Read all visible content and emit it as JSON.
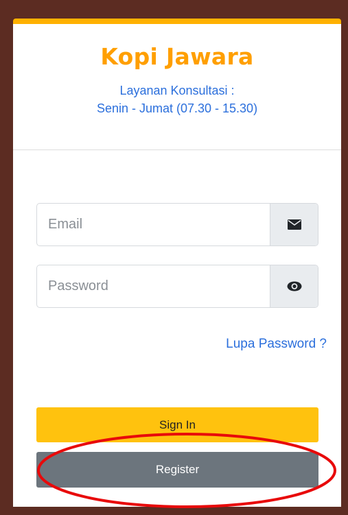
{
  "header": {
    "title": "Kopi Jawara",
    "consult_line1": "Layanan Konsultasi :",
    "consult_line2": "Senin - Jumat (07.30 - 15.30)"
  },
  "form": {
    "email_placeholder": "Email",
    "email_icon": "envelope-icon",
    "password_placeholder": "Password",
    "password_icon": "eye-icon",
    "forgot_label": "Lupa Password ?"
  },
  "actions": {
    "signin_label": "Sign In",
    "register_label": "Register"
  },
  "colors": {
    "page_background": "#5c2c22",
    "accent": "#ffb100",
    "title": "#ff9f00",
    "link": "#2b6fdc",
    "signin": "#ffc20e",
    "register": "#6c757d",
    "highlight": "#e8090a"
  }
}
